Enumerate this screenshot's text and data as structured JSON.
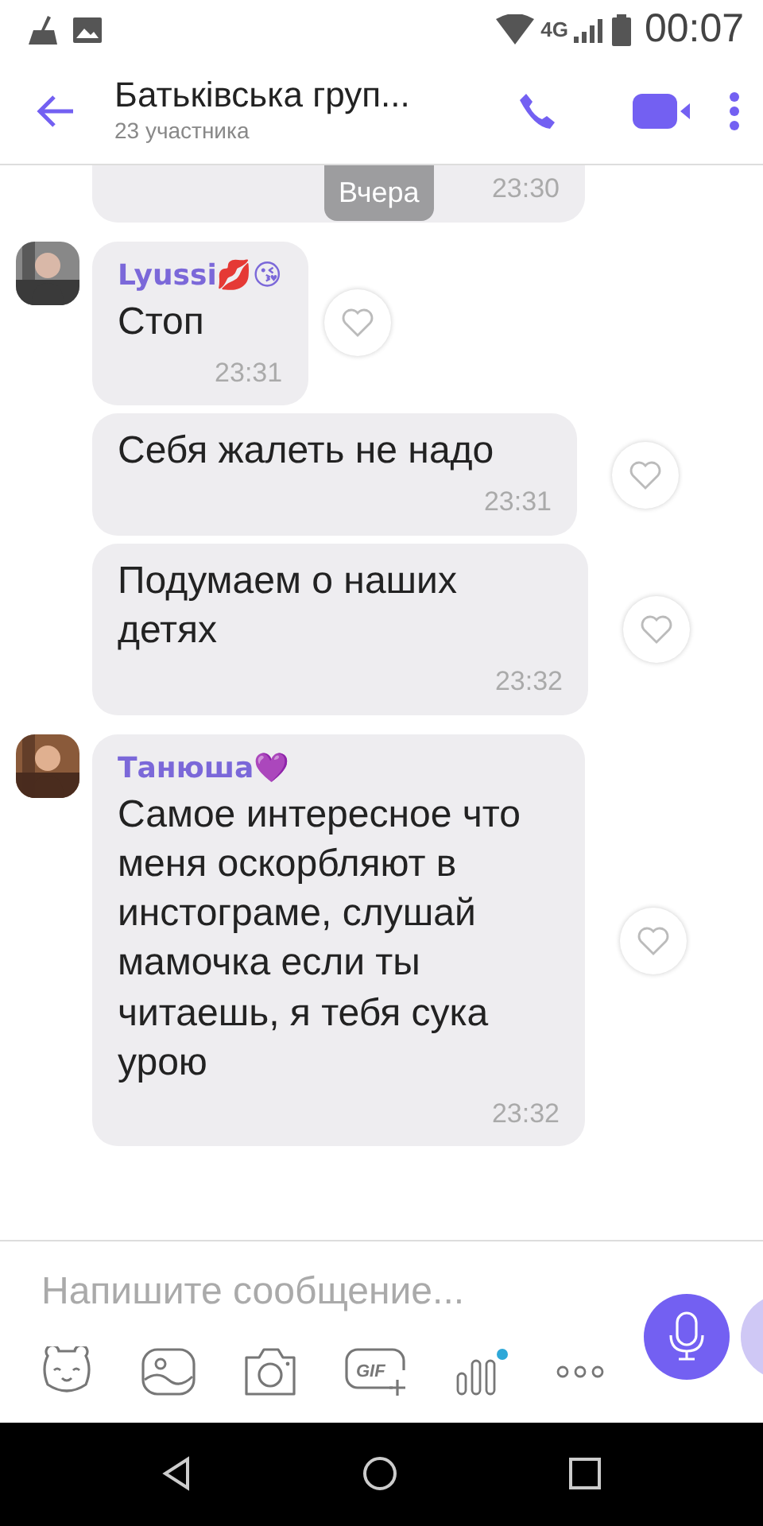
{
  "status_bar": {
    "network": "4G",
    "time": "00:07"
  },
  "header": {
    "title": "Батьківська груп...",
    "subtitle": "23 участника"
  },
  "date_pill": "Вчера",
  "partial_message": {
    "time": "23:30"
  },
  "messages": [
    {
      "kind": "first",
      "sender": "Lyussi💋😘",
      "text": "Стоп",
      "time": "23:31",
      "liked": false
    },
    {
      "kind": "follow",
      "text": "Себя жалеть не надо",
      "time": "23:31",
      "liked": false
    },
    {
      "kind": "follow",
      "text": "Подумаем о наших детях",
      "time": "23:32",
      "liked": false
    },
    {
      "kind": "first",
      "sender": "Танюша💜",
      "text": "Самое интересное что меня оскорбляют в инстограме, слушай мамочка если ты читаешь, я тебя сука урою",
      "time": "23:32",
      "liked": false
    }
  ],
  "composer": {
    "placeholder": "Напишите сообщение...",
    "gif_label": "GIF"
  }
}
